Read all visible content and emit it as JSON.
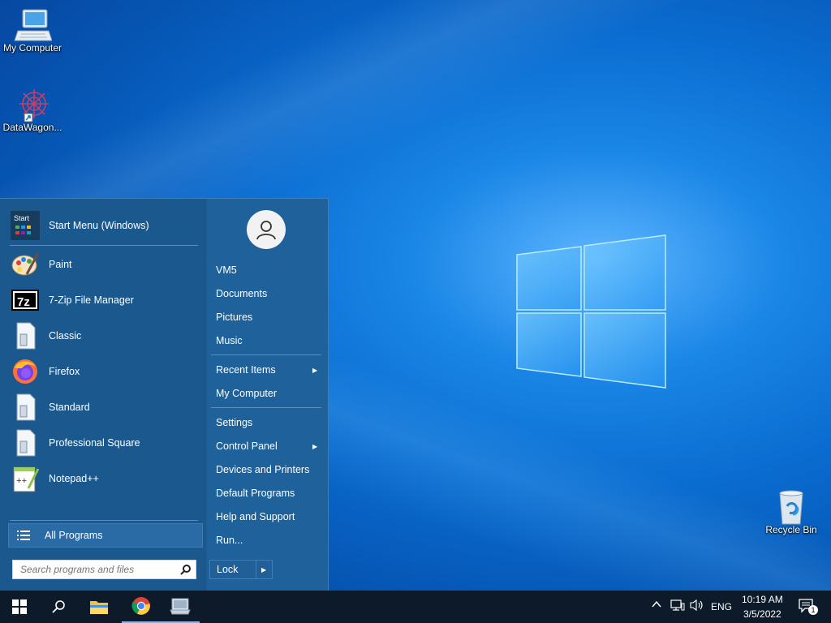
{
  "desktop": {
    "icons": [
      {
        "label": "My Computer",
        "icon": "computer-icon"
      },
      {
        "label": "DataWagon...",
        "icon": "datawagon-icon"
      },
      {
        "label": "Recycle Bin",
        "icon": "recycle-bin-icon"
      }
    ]
  },
  "start_menu": {
    "pinned": [
      {
        "label": "Start Menu (Windows)",
        "icon": "start-menu-icon"
      }
    ],
    "programs": [
      {
        "label": "Paint",
        "icon": "paint-icon"
      },
      {
        "label": "7-Zip File Manager",
        "icon": "7zip-icon"
      },
      {
        "label": "Classic",
        "icon": "document-icon"
      },
      {
        "label": "Firefox",
        "icon": "firefox-icon"
      },
      {
        "label": "Standard",
        "icon": "document-icon"
      },
      {
        "label": "Professional Square",
        "icon": "document-icon"
      },
      {
        "label": "Notepad++",
        "icon": "notepadpp-icon"
      }
    ],
    "all_programs_label": "All Programs",
    "search_placeholder": "Search programs and files",
    "right_items": {
      "user": "VM5",
      "documents": "Documents",
      "pictures": "Pictures",
      "music": "Music",
      "recent_items": "Recent Items",
      "my_computer": "My Computer",
      "settings": "Settings",
      "control_panel": "Control Panel",
      "devices_printers": "Devices and Printers",
      "default_programs": "Default Programs",
      "help_support": "Help and Support",
      "run": "Run..."
    },
    "lock_label": "Lock"
  },
  "taskbar": {
    "apps": [
      "start-icon",
      "search-icon",
      "file-explorer-icon",
      "chrome-icon",
      "app-icon"
    ],
    "tray": {
      "language": "ENG",
      "time": "10:19 AM",
      "date": "3/5/2022",
      "notification_count": "1"
    }
  },
  "colors": {
    "start_menu_bg": "#1b588e",
    "taskbar_bg": "#0d1a2a",
    "accent": "#0a6cd0"
  }
}
